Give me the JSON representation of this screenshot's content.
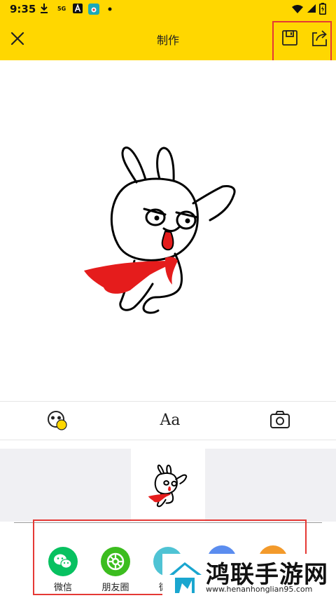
{
  "status_bar": {
    "time": "9:35",
    "network_label": "5G",
    "icons": [
      "download-icon",
      "a-badge-icon",
      "app-icon",
      "dot-icon",
      "wifi-icon",
      "signal-icon",
      "battery-icon"
    ]
  },
  "toolbar": {
    "title": "制作",
    "close_icon": "close-icon",
    "save_icon": "save-icon",
    "share_icon": "share-icon"
  },
  "tools": [
    "sticker-icon",
    "text-icon",
    "camera-icon"
  ],
  "text_tool_label": "Aa",
  "share": {
    "items": [
      {
        "label": "微信",
        "color": "#07c160"
      },
      {
        "label": "朋友圈",
        "color": "#3cbd1f"
      },
      {
        "label": "微信",
        "color": "#4fc3d4"
      }
    ]
  },
  "watermark": {
    "title": "鸿联手游网",
    "url": "www.henanhonglian95.com"
  },
  "colors": {
    "toolbar": "#ffd700",
    "highlight": "#e53935",
    "cape": "#e51c1c"
  }
}
